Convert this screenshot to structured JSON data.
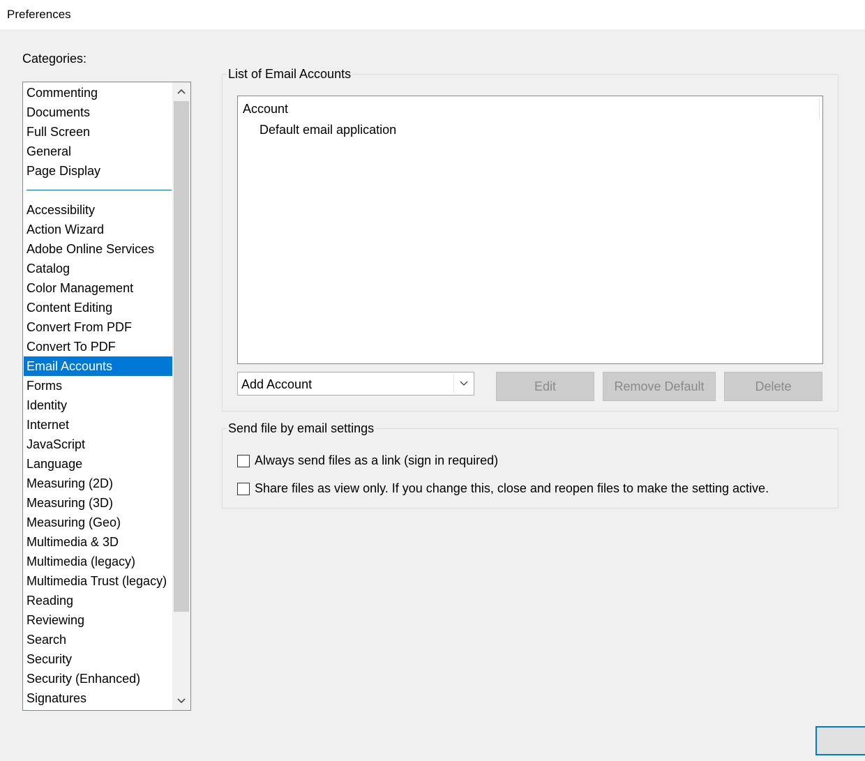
{
  "window": {
    "title": "Preferences"
  },
  "categories": {
    "label": "Categories:",
    "top_items": [
      "Commenting",
      "Documents",
      "Full Screen",
      "General",
      "Page Display"
    ],
    "items": [
      "Accessibility",
      "Action Wizard",
      "Adobe Online Services",
      "Catalog",
      "Color Management",
      "Content Editing",
      "Convert From PDF",
      "Convert To PDF",
      "Email Accounts",
      "Forms",
      "Identity",
      "Internet",
      "JavaScript",
      "Language",
      "Measuring (2D)",
      "Measuring (3D)",
      "Measuring (Geo)",
      "Multimedia & 3D",
      "Multimedia (legacy)",
      "Multimedia Trust (legacy)",
      "Reading",
      "Reviewing",
      "Search",
      "Security",
      "Security (Enhanced)",
      "Signatures"
    ],
    "selected": "Email Accounts",
    "selected_color": "#0078d7"
  },
  "email_accounts": {
    "group_title": "List of Email Accounts",
    "column_header": "Account",
    "rows": [
      "Default email application"
    ],
    "add_select_value": "Add Account",
    "edit_label": "Edit",
    "remove_default_label": "Remove Default",
    "delete_label": "Delete"
  },
  "send_settings": {
    "group_title": "Send file by email settings",
    "always_link_label": "Always send files as a link (sign in required)",
    "always_link_checked": false,
    "view_only_label": "Share files as view only. If you change this, close and reopen files to make the setting active.",
    "view_only_checked": false
  }
}
